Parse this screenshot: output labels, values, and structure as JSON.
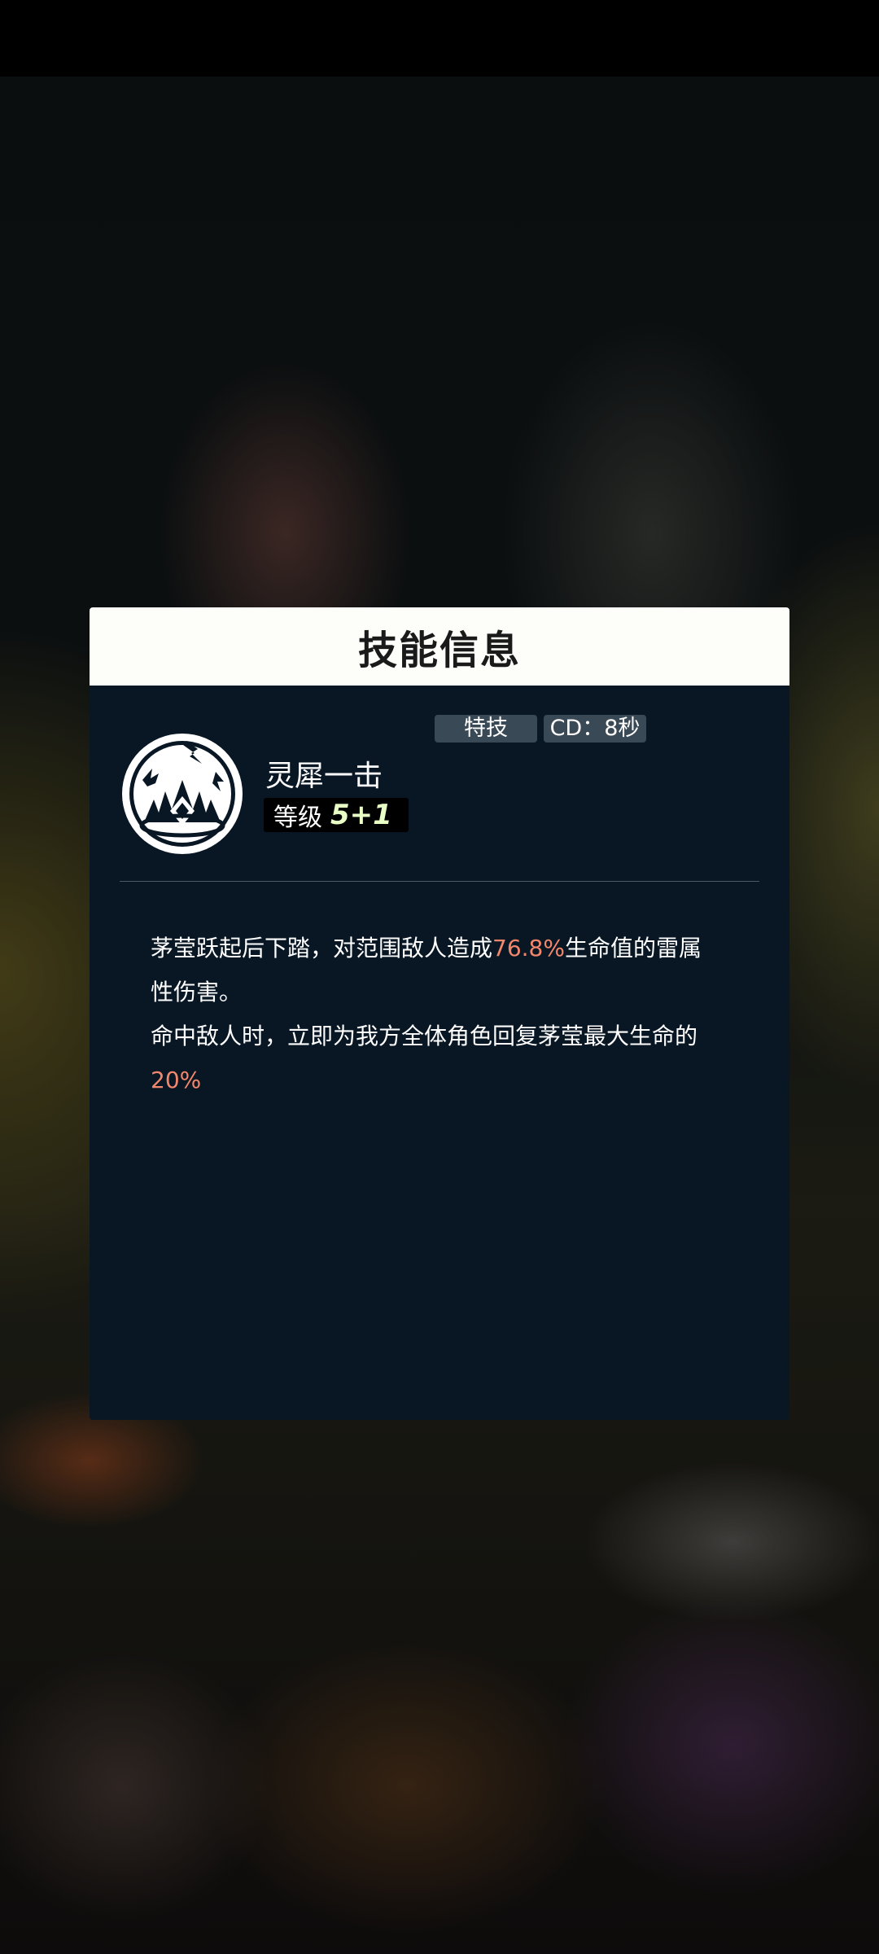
{
  "dialog": {
    "title": "技能信息"
  },
  "skill": {
    "icon": "skill-emblem-icon",
    "name": "灵犀一击",
    "level_label": "等级",
    "level_value": "5+1",
    "type_tag": "特技",
    "cooldown_tag": "CD：8秒"
  },
  "description": {
    "line1_a": "茅莹跃起后下踏，对范围敌人造成",
    "line1_value": "76.8%",
    "line1_b": "生命值的雷属性伤害。",
    "line2_a": "命中敌人时，立即为我方全体角色回复茅莹最大生命的",
    "line2_value": "20%"
  },
  "colors": {
    "panel_bg": "#091725",
    "header_bg": "#fdfdfa",
    "highlight": "#f2876c",
    "level_value": "#e8ffc6",
    "tag_bg": "#3a4956"
  }
}
